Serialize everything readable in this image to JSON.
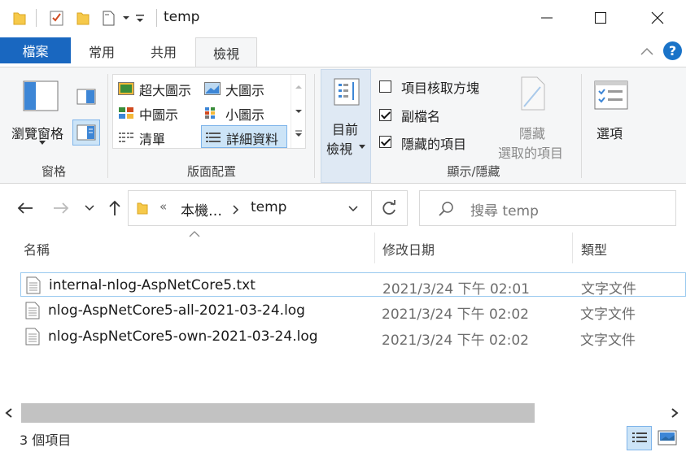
{
  "window": {
    "title": "temp",
    "minimize": "minimize",
    "maximize": "maximize",
    "close": "close"
  },
  "tabs": {
    "file": "檔案",
    "home": "常用",
    "share": "共用",
    "view": "檢視"
  },
  "ribbon": {
    "panes": {
      "nav_pane_label": "瀏覽窗格",
      "group_label": "窗格"
    },
    "layout": {
      "items": [
        "超大圖示",
        "大圖示",
        "中圖示",
        "小圖示",
        "清單",
        "詳細資料"
      ],
      "group_label": "版面配置"
    },
    "current_view": {
      "label_line1": "目前",
      "label_line2": "檢視"
    },
    "show_hide": {
      "item_checkboxes": "項目核取方塊",
      "file_extensions": "副檔名",
      "hidden_items": "隱藏的項目",
      "hide_selected_line1": "隱藏",
      "hide_selected_line2": "選取的項目",
      "group_label": "顯示/隱藏",
      "checks": [
        false,
        true,
        true
      ]
    },
    "options": {
      "label": "選項"
    }
  },
  "address": {
    "crumb1": "本機…",
    "crumb2": "temp",
    "prefix": "«",
    "search_placeholder": "搜尋 temp"
  },
  "columns": {
    "name": "名稱",
    "date": "修改日期",
    "type": "類型"
  },
  "files": [
    {
      "name": "internal-nlog-AspNetCore5.txt",
      "date": "2021/3/24 下午 02:01",
      "type": "文字文件"
    },
    {
      "name": "nlog-AspNetCore5-all-2021-03-24.log",
      "date": "2021/3/24 下午 02:02",
      "type": "文字文件"
    },
    {
      "name": "nlog-AspNetCore5-own-2021-03-24.log",
      "date": "2021/3/24 下午 02:02",
      "type": "文字文件"
    }
  ],
  "status": {
    "count": "3 個項目"
  },
  "colors": {
    "accent": "#1967c0",
    "help": "#1a73c8",
    "selection_border": "#99c9ef"
  }
}
